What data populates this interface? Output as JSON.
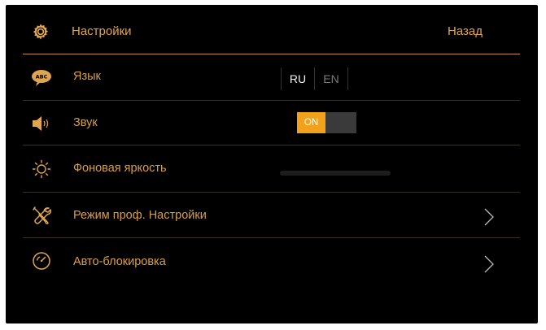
{
  "header": {
    "title": "Настройки",
    "back_label": "Назад",
    "icon": "gear-icon"
  },
  "language": {
    "label": "Язык",
    "icon": "speech-bubble-abc-icon",
    "options": [
      "RU",
      "EN"
    ],
    "selected": "RU"
  },
  "sound": {
    "label": "Звук",
    "icon": "speaker-icon",
    "toggle_label": "ON",
    "enabled": true
  },
  "brightness": {
    "label": "Фоновая яркость",
    "icon": "sun-icon",
    "level": 0
  },
  "pro_settings": {
    "label": "Режим проф. Настройки",
    "icon": "tools-icon"
  },
  "autolock": {
    "label": "Авто-блокировка",
    "icon": "timer-icon"
  },
  "colors": {
    "accent": "#e0a64d",
    "toggle_on": "#f3a01b",
    "background": "#000000"
  }
}
